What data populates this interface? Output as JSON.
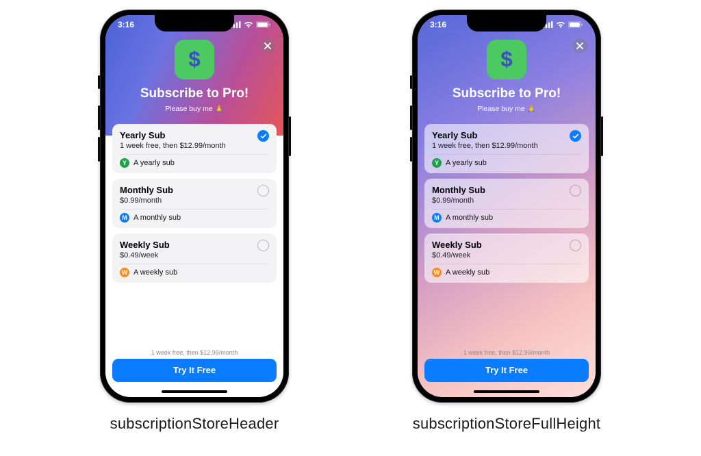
{
  "status": {
    "time": "3:16"
  },
  "header": {
    "title": "Subscribe to Pro!",
    "subtitle": "Please buy me 🙏"
  },
  "plans": [
    {
      "id": "yearly",
      "title": "Yearly Sub",
      "price_line": "1 week free, then $12.99/month",
      "badge_letter": "Y",
      "desc": "A yearly sub",
      "selected": true
    },
    {
      "id": "monthly",
      "title": "Monthly Sub",
      "price_line": "$0.99/month",
      "badge_letter": "M",
      "desc": "A monthly sub",
      "selected": false
    },
    {
      "id": "weekly",
      "title": "Weekly Sub",
      "price_line": "$0.49/week",
      "badge_letter": "W",
      "desc": "A weekly sub",
      "selected": false
    }
  ],
  "cta": {
    "fine_print": "1 week free, then $12.99/month",
    "label": "Try It Free"
  },
  "captions": {
    "left": "subscriptionStoreHeader",
    "right": "subscriptionStoreFullHeight"
  }
}
